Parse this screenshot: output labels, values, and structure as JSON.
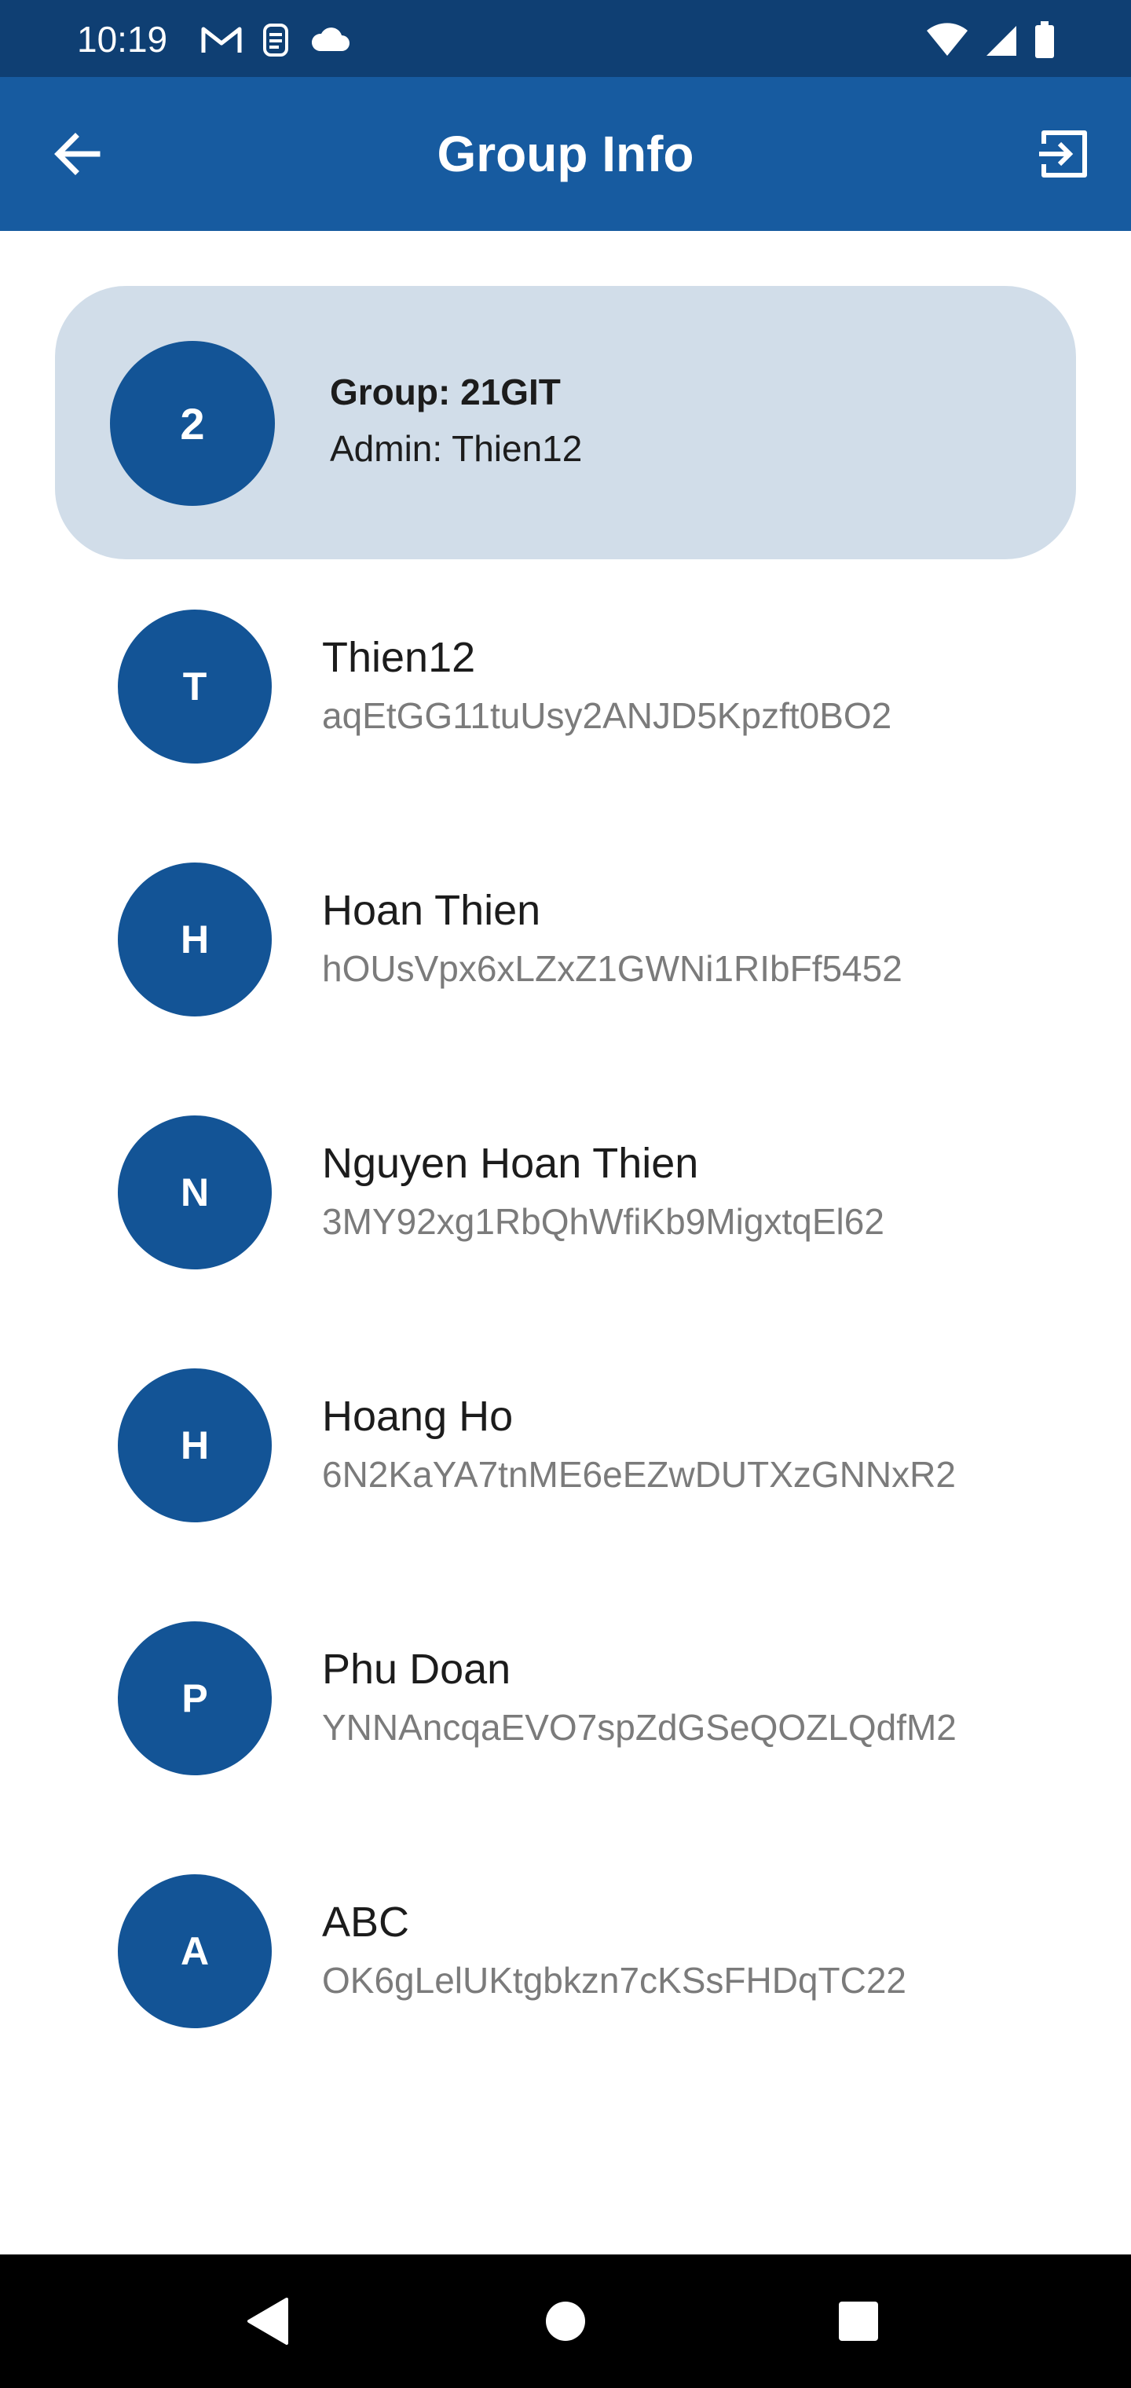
{
  "status_bar": {
    "time": "10:19",
    "left_icons": [
      "gmail-icon",
      "sim-toolkit-icon",
      "cloud-icon"
    ],
    "right_icons": [
      "wifi-icon",
      "signal-icon",
      "battery-icon"
    ]
  },
  "app_bar": {
    "title": "Group Info",
    "back_icon": "arrow-back-icon",
    "exit_icon": "exit-to-app-icon"
  },
  "group": {
    "avatar_text": "2",
    "name": "Group: 21GIT",
    "admin": "Admin: Thien12"
  },
  "members": [
    {
      "initial": "T",
      "name": "Thien12",
      "id": "aqEtGG11tuUsy2ANJD5Kpzft0BO2"
    },
    {
      "initial": "H",
      "name": "Hoan Thien",
      "id": "hOUsVpx6xLZxZ1GWNi1RIbFf5452"
    },
    {
      "initial": "N",
      "name": "Nguyen Hoan Thien",
      "id": "3MY92xg1RbQhWfiKb9MigxtqEl62"
    },
    {
      "initial": "H",
      "name": "Hoang Ho",
      "id": "6N2KaYA7tnME6eEZwDUTXzGNNxR2"
    },
    {
      "initial": "P",
      "name": "Phu Doan",
      "id": "YNNAncqaEVO7spZdGSeQOZLQdfM2"
    },
    {
      "initial": "A",
      "name": "ABC",
      "id": "OK6gLelUKtgbkzn7cKSsFHDqTC22"
    }
  ],
  "nav_bar": {
    "back_icon": "nav-back-icon",
    "home_icon": "nav-home-icon",
    "recents_icon": "nav-recents-icon"
  },
  "colors": {
    "status_bar": "#0f3f73",
    "app_bar": "#175ba0",
    "avatar": "#135496",
    "group_card": "#d1dde9"
  }
}
